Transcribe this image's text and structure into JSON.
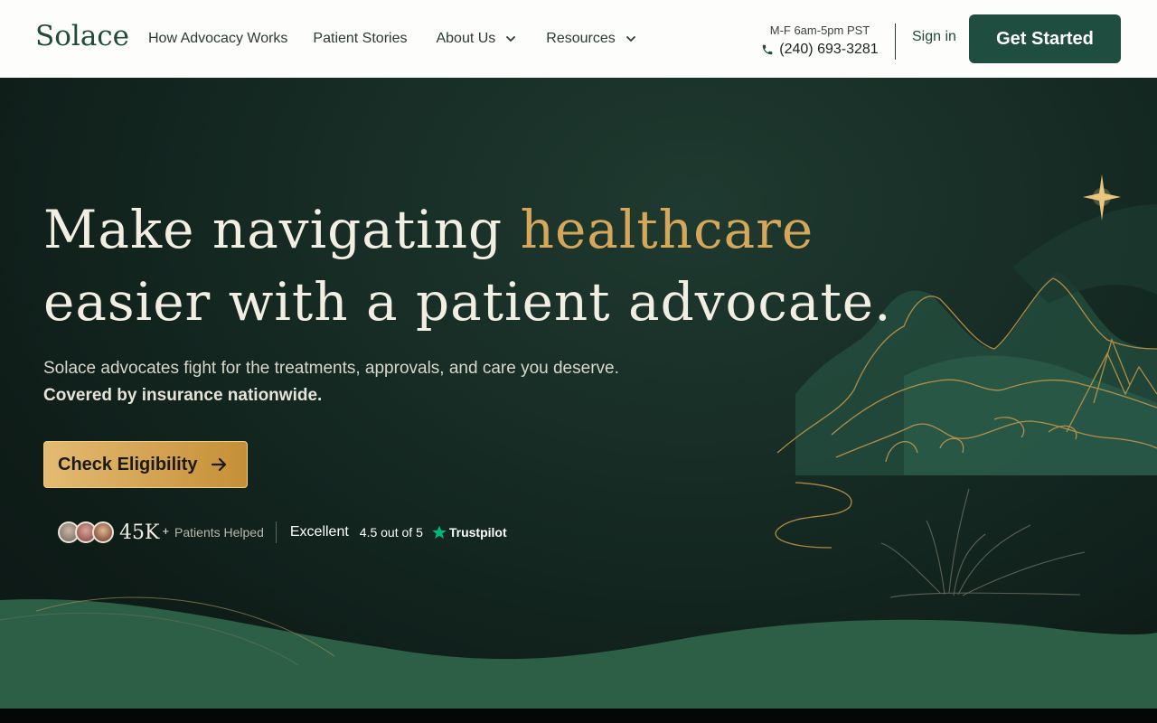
{
  "brand": {
    "logo_text": "Solace"
  },
  "nav": {
    "links": [
      {
        "label": "How Advocacy Works"
      },
      {
        "label": "Patient Stories"
      },
      {
        "label": "About Us"
      },
      {
        "label": "Resources"
      }
    ],
    "hours": "M-F 6am-5pm PST",
    "phone": "(240) 693-3281",
    "signin": "Sign in",
    "cta": "Get Started"
  },
  "hero": {
    "headline_line1_a": "Make navigating ",
    "headline_line1_b": "healthcare",
    "headline_line2": "easier with a patient advocate.",
    "subtitle": "Solace advocates fight for the treatments, approvals, and care you deserve.",
    "subtitle_bold": "Covered by insurance nationwide.",
    "button": "Check Eligibility"
  },
  "social_proof": {
    "count": "45K",
    "plus": "+",
    "label": "Patients Helped",
    "excellent": "Excellent",
    "rating": "4.5 out of 5",
    "trustpilot": "Trustpilot"
  },
  "colors": {
    "brand_green": "#1f4d40",
    "gold": "#d4a75a",
    "trustpilot_green": "#00b67a",
    "hero_bg": "#162b24"
  }
}
